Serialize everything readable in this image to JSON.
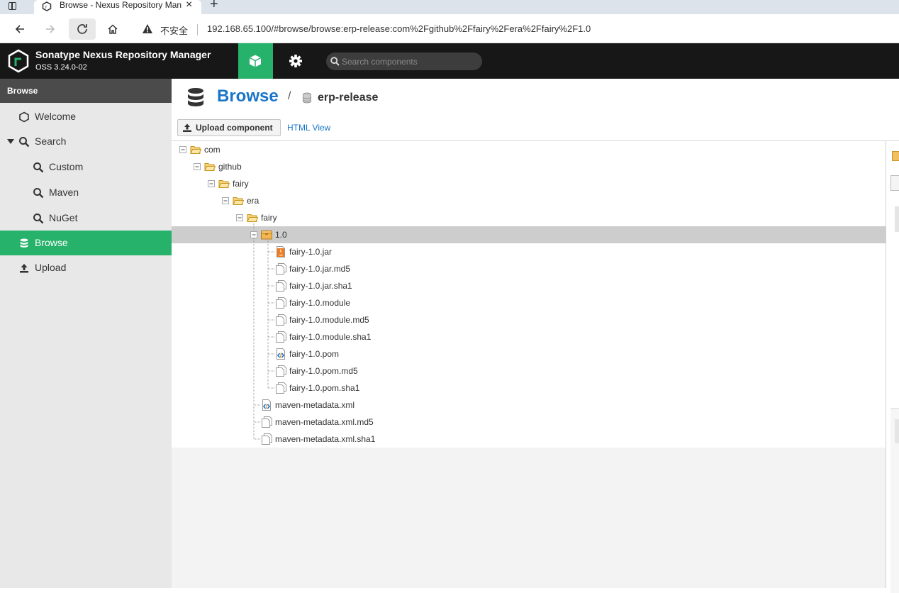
{
  "browser": {
    "tab_title": "Browse - Nexus Repository Manager",
    "address": {
      "security_label": "不安全",
      "url": "192.168.65.100/#browse/browse:erp-release:com%2Fgithub%2Ffairy%2Fera%2Ffairy%2F1.0"
    }
  },
  "header": {
    "app_title": "Sonatype Nexus Repository Manager",
    "version": "OSS 3.24.0-02",
    "search_placeholder": "Search components"
  },
  "sidebar": {
    "heading": "Browse",
    "items": [
      {
        "label": "Welcome",
        "icon": "hexagon-icon"
      },
      {
        "label": "Search",
        "icon": "search-icon",
        "expanded": true
      },
      {
        "label": "Custom",
        "icon": "search-icon"
      },
      {
        "label": "Maven",
        "icon": "search-icon"
      },
      {
        "label": "NuGet",
        "icon": "search-icon"
      },
      {
        "label": "Browse",
        "icon": "database-icon",
        "active": true
      },
      {
        "label": "Upload",
        "icon": "upload-icon"
      }
    ]
  },
  "breadcrumb": {
    "root": "Browse",
    "separator": "/",
    "repository": "erp-release"
  },
  "toolbar": {
    "upload_label": "Upload component",
    "html_view_label": "HTML View"
  },
  "tree": {
    "nodes": [
      {
        "label": "com",
        "depth": 0,
        "icon": "folder-open-icon"
      },
      {
        "label": "github",
        "depth": 1,
        "icon": "folder-open-icon"
      },
      {
        "label": "fairy",
        "depth": 2,
        "icon": "folder-open-icon"
      },
      {
        "label": "era",
        "depth": 3,
        "icon": "folder-open-icon"
      },
      {
        "label": "fairy",
        "depth": 4,
        "icon": "folder-open-icon"
      },
      {
        "label": "1.0",
        "depth": 5,
        "icon": "package-icon",
        "selected": true
      },
      {
        "label": "fairy-1.0.jar",
        "depth": 6,
        "icon": "java-file-icon"
      },
      {
        "label": "fairy-1.0.jar.md5",
        "depth": 6,
        "icon": "file-icon"
      },
      {
        "label": "fairy-1.0.jar.sha1",
        "depth": 6,
        "icon": "file-icon"
      },
      {
        "label": "fairy-1.0.module",
        "depth": 6,
        "icon": "file-icon"
      },
      {
        "label": "fairy-1.0.module.md5",
        "depth": 6,
        "icon": "file-icon"
      },
      {
        "label": "fairy-1.0.module.sha1",
        "depth": 6,
        "icon": "file-icon"
      },
      {
        "label": "fairy-1.0.pom",
        "depth": 6,
        "icon": "xml-file-icon"
      },
      {
        "label": "fairy-1.0.pom.md5",
        "depth": 6,
        "icon": "file-icon"
      },
      {
        "label": "fairy-1.0.pom.sha1",
        "depth": 6,
        "icon": "file-icon"
      },
      {
        "label": "maven-metadata.xml",
        "depth": 5,
        "icon": "xml-file-icon"
      },
      {
        "label": "maven-metadata.xml.md5",
        "depth": 5,
        "icon": "file-icon"
      },
      {
        "label": "maven-metadata.xml.sha1",
        "depth": 5,
        "icon": "file-icon"
      }
    ]
  },
  "colors": {
    "accent": "#27b26b",
    "header_bg": "#171717",
    "link": "#1975c8",
    "selection": "#cdcdcd"
  }
}
